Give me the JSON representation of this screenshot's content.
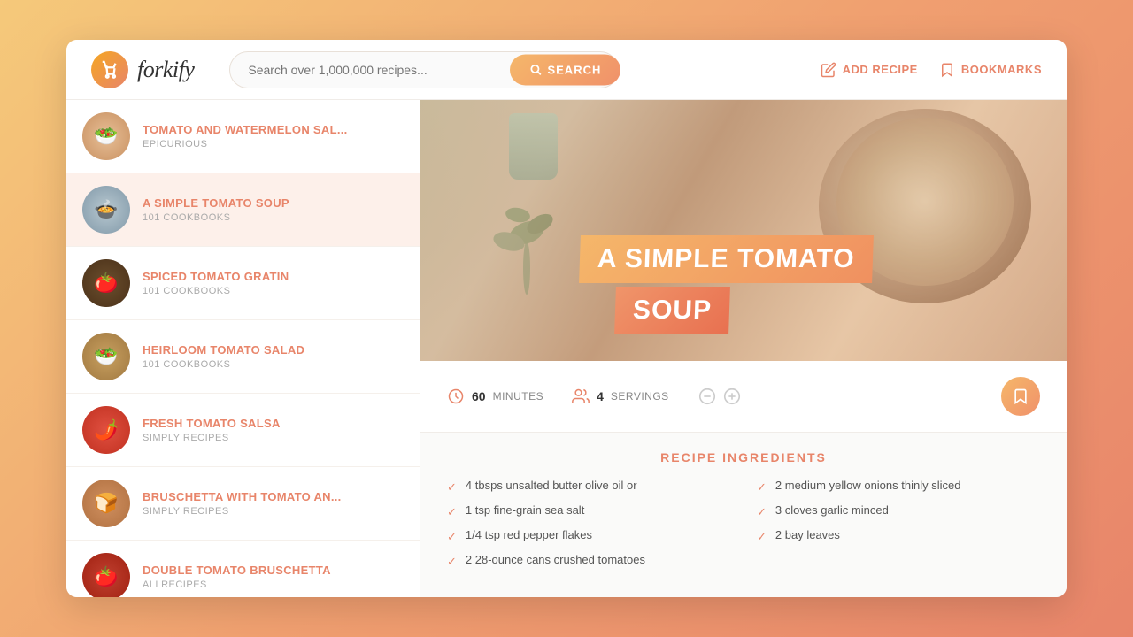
{
  "app": {
    "name": "forkify",
    "logo_icon": "🍴",
    "search_placeholder": "Search over 1,000,000 recipes...",
    "search_button_label": "SEARCH",
    "add_recipe_label": "ADD RECIPE",
    "bookmarks_label": "BOOKMARKS"
  },
  "recipe_list": [
    {
      "id": 1,
      "title": "TOMATO AND WATERMELON SAL...",
      "source": "EPICURIOUS",
      "emoji": "🥗",
      "active": false
    },
    {
      "id": 2,
      "title": "A SIMPLE TOMATO SOUP",
      "source": "101 COOKBOOKS",
      "emoji": "🍲",
      "active": true
    },
    {
      "id": 3,
      "title": "SPICED TOMATO GRATIN",
      "source": "101 COOKBOOKS",
      "emoji": "🍅",
      "active": false
    },
    {
      "id": 4,
      "title": "HEIRLOOM TOMATO SALAD",
      "source": "101 COOKBOOKS",
      "emoji": "🥗",
      "active": false
    },
    {
      "id": 5,
      "title": "FRESH TOMATO SALSA",
      "source": "SIMPLY RECIPES",
      "emoji": "🌶️",
      "active": false
    },
    {
      "id": 6,
      "title": "BRUSCHETTA WITH TOMATO AN...",
      "source": "SIMPLY RECIPES",
      "emoji": "🍞",
      "active": false
    },
    {
      "id": 7,
      "title": "DOUBLE TOMATO BRUSCHETTA",
      "source": "ALLRECIPES",
      "emoji": "🍅",
      "active": false
    }
  ],
  "current_recipe": {
    "title_line1": "A SIMPLE TOMATO",
    "title_line2": "SOUP",
    "minutes": "60",
    "minutes_label": "MINUTES",
    "servings": "4",
    "servings_label": "SERVINGS",
    "ingredients_title": "RECIPE INGREDIENTS",
    "ingredients": [
      "4 tbsps unsalted butter olive oil or",
      "2 medium yellow onions thinly sliced",
      "1 tsp fine-grain sea salt",
      "3 cloves garlic minced",
      "1/4 tsp red pepper flakes",
      "2 bay leaves",
      "2 28-ounce cans crushed tomatoes"
    ]
  }
}
